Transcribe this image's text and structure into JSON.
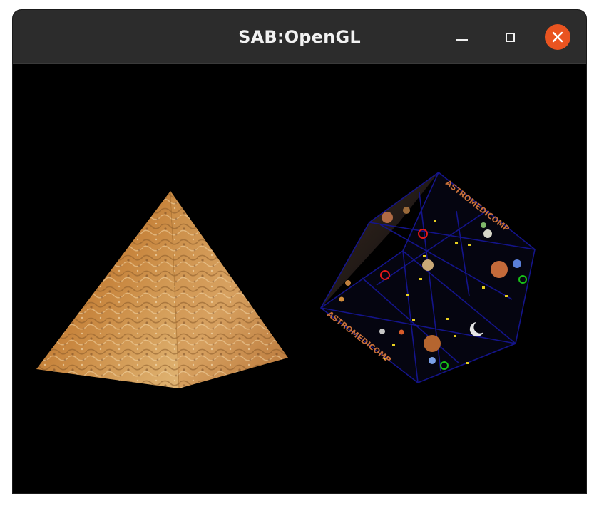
{
  "window": {
    "title": "SAB:OpenGL",
    "controls": {
      "minimize": "minimize-icon",
      "maximize": "maximize-icon",
      "close": "close-icon"
    },
    "accent_color": "#e95420",
    "titlebar_color": "#2c2c2c"
  },
  "scene": {
    "background_color": "#000000",
    "cube_face_text": "ASTROMEDICOMP"
  }
}
